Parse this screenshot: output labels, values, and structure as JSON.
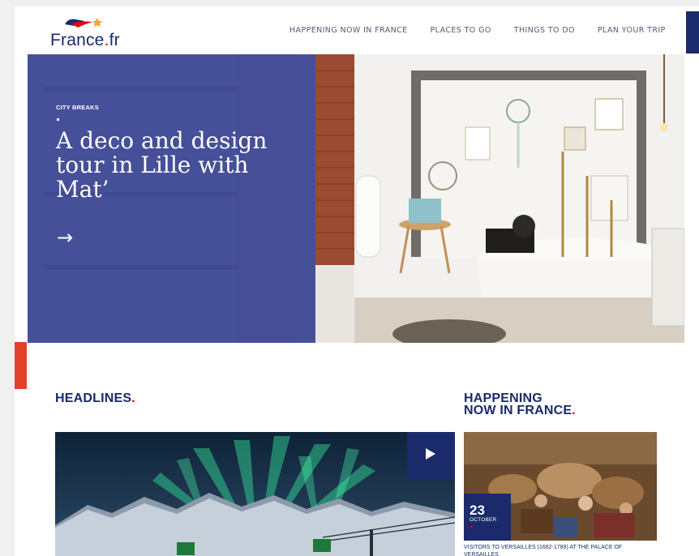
{
  "brand": {
    "logo_text": "France",
    "logo_tld": "fr"
  },
  "nav": {
    "items": [
      "HAPPENING NOW IN FRANCE",
      "PLACES TO GO",
      "THINGS TO DO",
      "PLAN YOUR TRIP"
    ]
  },
  "hero": {
    "eyebrow": "CITY BREAKS",
    "title": "A deco and design tour in Lille with Mat’",
    "arrow": "→"
  },
  "headlines": {
    "title": "HEADLINES"
  },
  "happening": {
    "title_line1": "HAPPENING",
    "title_line2": "NOW IN FRANCE",
    "event": {
      "day": "23",
      "month": "OCTOBER",
      "caption": "VISITORS TO VERSAILLES (1682-1789) AT THE PALACE OF VERSAILLES"
    }
  },
  "colors": {
    "brand_blue": "#1b2a6b",
    "accent_red": "#e1000f",
    "overlay_blue": "#26328c"
  }
}
